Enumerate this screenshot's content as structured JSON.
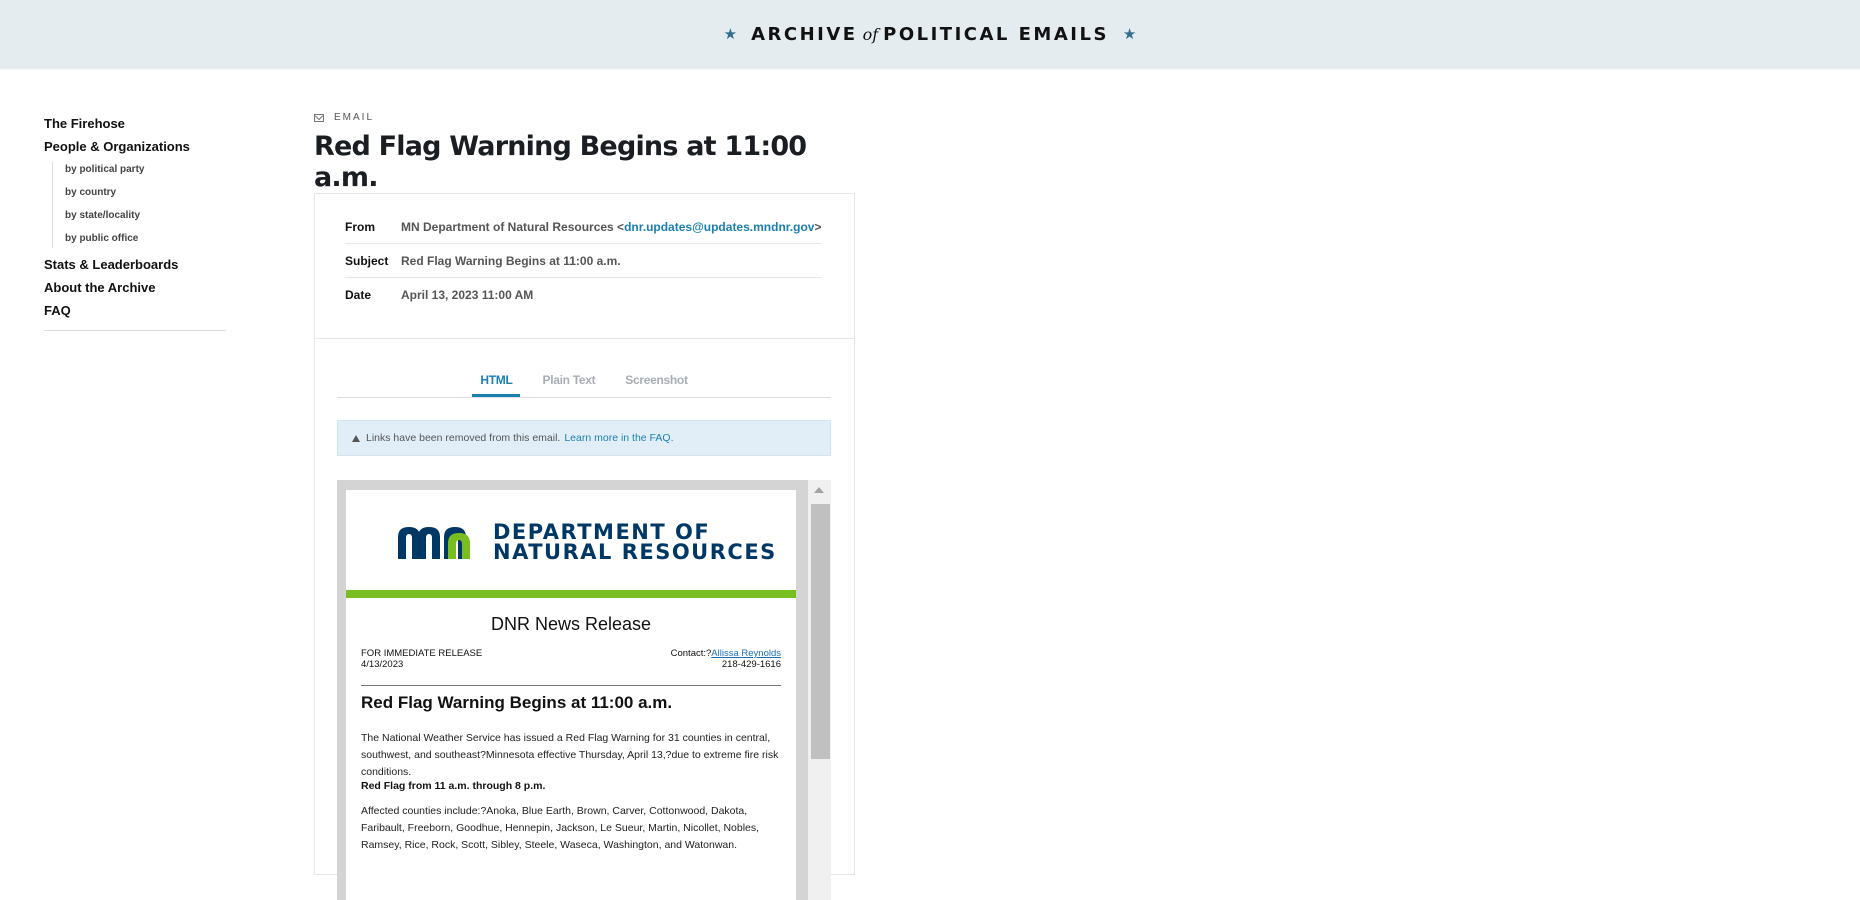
{
  "site": {
    "title_left": "ARCHIVE",
    "title_of": "of",
    "title_right": "POLITICAL EMAILS",
    "star": "★"
  },
  "sidebar": {
    "items": [
      {
        "label": "The Firehose"
      },
      {
        "label": "People & Organizations"
      }
    ],
    "subitems": [
      {
        "label": "by political party"
      },
      {
        "label": "by country"
      },
      {
        "label": "by state/locality"
      },
      {
        "label": "by public office"
      }
    ],
    "items_after": [
      {
        "label": "Stats & Leaderboards"
      },
      {
        "label": "About the Archive"
      },
      {
        "label": "FAQ"
      }
    ]
  },
  "main": {
    "kicker": "EMAIL",
    "title": "Red Flag Warning Begins at 11:00 a.m."
  },
  "meta": {
    "from_label": "From",
    "from_name": "MN Department of Natural Resources <",
    "from_email": "dnr.updates@updates.mndnr.gov",
    "from_close": ">",
    "subject_label": "Subject",
    "subject": "Red Flag Warning Begins at 11:00 a.m.",
    "date_label": "Date",
    "date": "April 13, 2023 11:00 AM"
  },
  "tabs": [
    {
      "label": "HTML",
      "active": true
    },
    {
      "label": "Plain Text",
      "active": false
    },
    {
      "label": "Screenshot",
      "active": false
    }
  ],
  "notice": {
    "text": "Links have been removed from this email.",
    "link": "Learn more in the FAQ."
  },
  "email": {
    "logo_line1": "DEPARTMENT OF",
    "logo_line2": "NATURAL RESOURCES",
    "release_title": "DNR News Release",
    "for_release": "FOR IMMEDIATE RELEASE",
    "release_date": "4/13/2023",
    "contact_label": "Contact:?",
    "contact_name": "Allissa Reynolds",
    "contact_phone": "218-429-1616",
    "heading": "Red Flag Warning Begins at 11:00 a.m.",
    "p1": "The National Weather Service has issued a Red Flag Warning for 31 counties in central, southwest, and southeast?Minnesota effective Thursday, April 13,?due to extreme fire risk conditions.",
    "bold1": "Red Flag from 11 a.m. through 8 p.m.",
    "p2": "Affected counties include:?Anoka, Blue Earth, Brown, Carver, Cottonwood, Dakota, Faribault, Freeborn, Goodhue, Hennepin, Jackson, Le Sueur, Martin, Nicollet, Nobles, Ramsey, Rice, Rock, Scott, Sibley, Steele, Waseca, Washington, and Watonwan."
  },
  "colors": {
    "banner_bg": "#e4ecef",
    "accent": "#1b7fb0",
    "dnr_blue": "#003865",
    "dnr_green": "#78be20"
  }
}
